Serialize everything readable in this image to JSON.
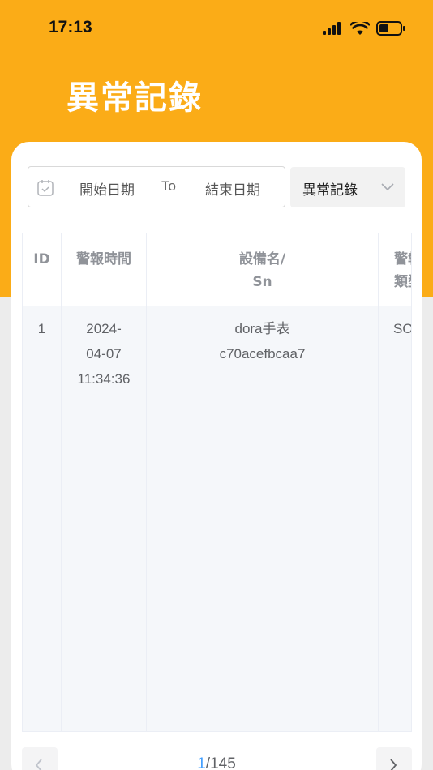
{
  "status_bar": {
    "time": "17:13"
  },
  "header": {
    "title": "異常記錄"
  },
  "filters": {
    "start_placeholder": "開始日期",
    "separator": "To",
    "end_placeholder": "結束日期",
    "type_selected": "異常記錄"
  },
  "table": {
    "headers": {
      "id": "ID",
      "alarm_time": "警報時間",
      "device_line1": "設備名/",
      "device_line2": "Sn",
      "alarm_type_line1": "警報",
      "alarm_type_line2": "類型"
    },
    "rows": [
      {
        "id": "1",
        "time_line1": "2024-",
        "time_line2": "04-07",
        "time_line3": "11:34:36",
        "device_name": "dora手表",
        "device_sn": "c70acefbcaa7",
        "alarm_type": "SOS"
      }
    ]
  },
  "pagination": {
    "current": "1",
    "total": "/145"
  },
  "colors": {
    "brand": "#fbac17",
    "page_active": "#409eff"
  }
}
